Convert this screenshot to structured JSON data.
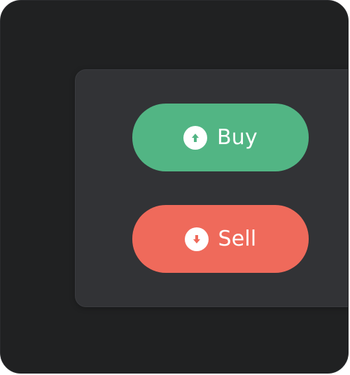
{
  "actions": {
    "buy": {
      "label": "Buy",
      "icon": "arrow-up-circle-icon",
      "color": "#52b584"
    },
    "sell": {
      "label": "Sell",
      "icon": "arrow-down-circle-icon",
      "color": "#ef6a5b"
    }
  },
  "theme": {
    "background": "#202122",
    "panel": "#323336",
    "text": "#ffffff"
  }
}
